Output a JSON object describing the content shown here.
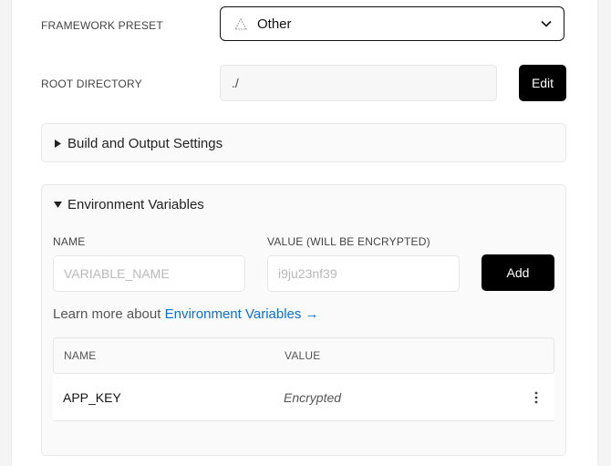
{
  "framework": {
    "label": "FRAMEWORK PRESET",
    "value": "Other"
  },
  "root": {
    "label": "ROOT DIRECTORY",
    "value": "./",
    "edit_label": "Edit"
  },
  "build": {
    "title": "Build and Output Settings"
  },
  "env": {
    "title": "Environment Variables",
    "name_label": "NAME",
    "value_label": "VALUE (WILL BE ENCRYPTED)",
    "name_placeholder": "VARIABLE_NAME",
    "value_placeholder": "i9ju23nf39",
    "add_label": "Add",
    "learn_prefix": "Learn more about",
    "learn_link": "Environment Variables →",
    "table": {
      "headers": [
        "NAME",
        "VALUE"
      ],
      "rows": [
        {
          "name": "APP_KEY",
          "value": "Encrypted"
        }
      ]
    }
  },
  "icons": {
    "framework": "triangle-outline-icon",
    "dropdown": "chevron-down-icon",
    "collapsed": "caret-right-icon",
    "expanded": "caret-down-icon",
    "row_menu": "more-vertical-icon"
  }
}
